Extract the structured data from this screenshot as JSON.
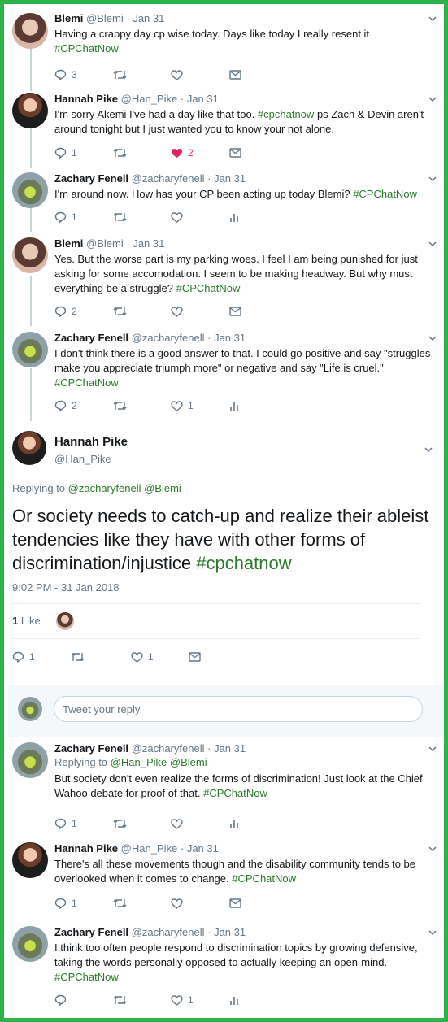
{
  "tweets_before": [
    {
      "name": "Blemi",
      "handle": "@Blemi",
      "date": "Jan 31",
      "avatar": "blemi-avatar",
      "text": "Having a crappy day cp wise today. Days like today I really resent it",
      "tag": "#CPChatNow",
      "replies": "3",
      "retweets": "",
      "likes": "",
      "last": "mail"
    },
    {
      "name": "Hannah Pike",
      "handle": "@Han_Pike",
      "date": "Jan 31",
      "avatar": "hannah-avatar",
      "text": "I'm sorry Akemi I've had a day like that too.",
      "tag": "#cpchatnow",
      "text2": "ps Zach & Devin aren't around tonight but I just wanted you to know your not alone.",
      "replies": "1",
      "retweets": "",
      "likes": "2",
      "liked": true,
      "last": "mail"
    },
    {
      "name": "Zachary Fenell",
      "handle": "@zacharyfenell",
      "date": "Jan 31",
      "avatar": "zach-avatar",
      "text": "I'm around now. How has your CP been acting up today Blemi?",
      "tag": "#CPChatNow",
      "replies": "1",
      "retweets": "",
      "likes": "",
      "last": "analytics"
    },
    {
      "name": "Blemi",
      "handle": "@Blemi",
      "date": "Jan 31",
      "avatar": "blemi-avatar",
      "text": "Yes. But the worse part is my parking woes. I feel I am being punished for just asking for some accomodation. I seem to be making headway. But why must everything be a struggle?",
      "tag": "#CPChatNow",
      "replies": "2",
      "retweets": "",
      "likes": "",
      "last": "mail"
    },
    {
      "name": "Zachary Fenell",
      "handle": "@zacharyfenell",
      "date": "Jan 31",
      "avatar": "zach-avatar",
      "text": "I don't think there is a good answer to that. I could go positive and say \"struggles make you appreciate triumph more\" or negative and say \"Life is cruel.\"",
      "tag": "#CPChatNow",
      "replies": "2",
      "retweets": "",
      "likes": "1",
      "last": "analytics"
    }
  ],
  "focus": {
    "name": "Hannah Pike",
    "handle": "@Han_Pike",
    "replying_label": "Replying to",
    "replying_to_1": "@zacharyfenell",
    "replying_to_2": "@Blemi",
    "text": "Or society needs to catch-up and realize their ableist tendencies like they have with other forms of discrimination/injustice",
    "tag": "#cpchatnow",
    "timestamp": "9:02 PM - 31 Jan 2018",
    "like_count": "1",
    "like_label": "Like",
    "replies": "1",
    "likes": "1"
  },
  "reply_box": {
    "placeholder": "Tweet your reply"
  },
  "tweets_after": [
    {
      "name": "Zachary Fenell",
      "handle": "@zacharyfenell",
      "date": "Jan 31",
      "replying_label": "Replying to",
      "replying_to_1": "@Han_Pike",
      "replying_to_2": "@Blemi",
      "text": "But society don't even realize the forms of discrimination! Just look at the Chief Wahoo debate for proof of that.",
      "tag": "#CPChatNow",
      "replies": "1",
      "likes": "",
      "last": "analytics"
    },
    {
      "name": "Hannah Pike",
      "handle": "@Han_Pike",
      "date": "Jan 31",
      "text": "There's all these movements though and the disability community tends to be overlooked when it comes to change.",
      "tag": "#CPChatNow",
      "replies": "1",
      "likes": "",
      "last": "mail"
    },
    {
      "name": "Zachary Fenell",
      "handle": "@zacharyfenell",
      "date": "Jan 31",
      "text": "I think too often people respond to discrimination topics by growing defensive, taking the words personally opposed to actually keeping an open-mind.",
      "tag": "#CPChatNow",
      "replies": "",
      "likes": "1",
      "last": "analytics"
    }
  ],
  "colors": {
    "border": "#2db34a",
    "hashtag": "#2b7a2b",
    "like_red": "#e0245e",
    "meta_gray": "#657786"
  }
}
